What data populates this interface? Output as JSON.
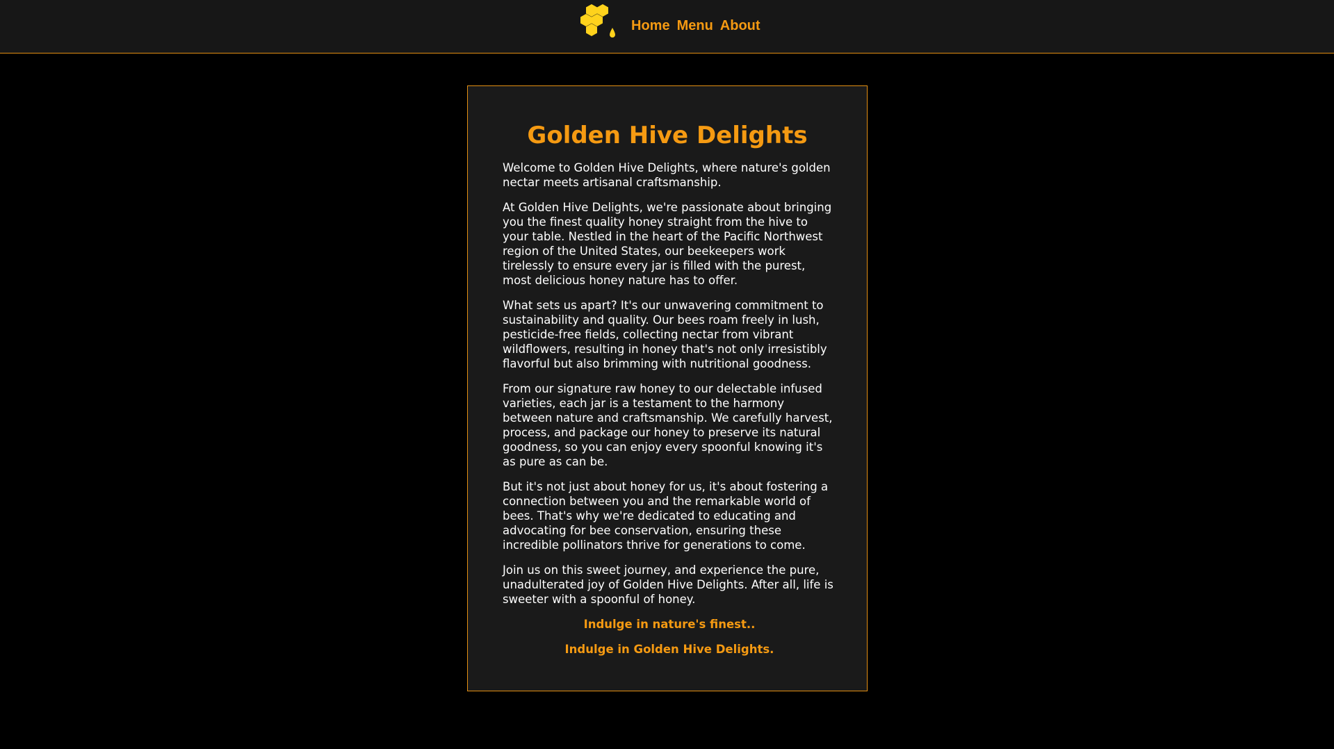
{
  "brand": {
    "logo_icon": "honeycomb-honey-drop-icon",
    "accent_color": "#f59a12",
    "honey_color": "#ffd21c"
  },
  "nav": {
    "items": [
      {
        "label": "Home"
      },
      {
        "label": "Menu"
      },
      {
        "label": "About"
      }
    ]
  },
  "main": {
    "title": "Golden Hive Delights",
    "paragraphs": [
      "Welcome to Golden Hive Delights, where nature's golden nectar meets artisanal craftsmanship.",
      "At Golden Hive Delights, we're passionate about bringing you the finest quality honey straight from the hive to your table. Nestled in the heart of the Pacific Northwest region of the United States, our beekeepers work tirelessly to ensure every jar is filled with the purest, most delicious honey nature has to offer.",
      "What sets us apart? It's our unwavering commitment to sustainability and quality. Our bees roam freely in lush, pesticide-free fields, collecting nectar from vibrant wildflowers, resulting in honey that's not only irresistibly flavorful but also brimming with nutritional goodness.",
      "From our signature raw honey to our delectable infused varieties, each jar is a testament to the harmony between nature and craftsmanship. We carefully harvest, process, and package our honey to preserve its natural goodness, so you can enjoy every spoonful knowing it's as pure as can be.",
      "But it's not just about honey for us, it's about fostering a connection between you and the remarkable world of bees. That's why we're dedicated to educating and advocating for bee conservation, ensuring these incredible pollinators thrive for generations to come.",
      "Join us on this sweet journey, and experience the pure, unadulterated joy of Golden Hive Delights. After all, life is sweeter with a spoonful of honey."
    ],
    "taglines": [
      "Indulge in nature's finest..",
      "Indulge in Golden Hive Delights."
    ]
  }
}
